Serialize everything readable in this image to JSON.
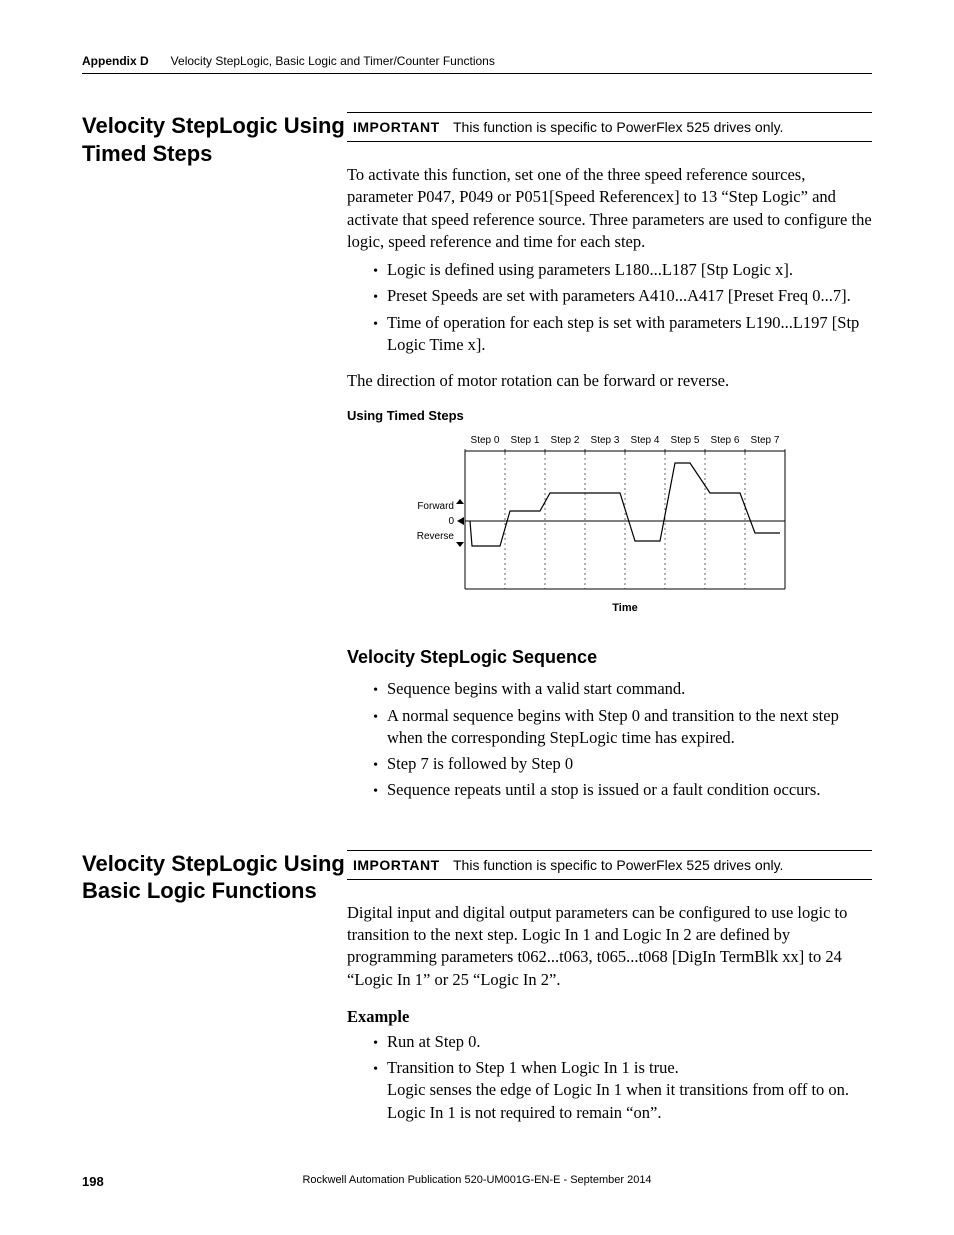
{
  "header": {
    "appendix": "Appendix D",
    "title": "Velocity StepLogic, Basic Logic and Timer/Counter Functions"
  },
  "section1": {
    "heading_l1": "Velocity StepLogic Using",
    "heading_l2": "Timed Steps",
    "important_label": "IMPORTANT",
    "important_text": "This function is specific to PowerFlex 525 drives only.",
    "para1": "To activate this function, set one of the three speed reference sources, parameter P047, P049 or P051[Speed Referencex] to 13 “Step Logic” and activate that speed reference source. Three parameters are used to configure the logic, speed reference and time for each step.",
    "bullets": [
      "Logic is defined using parameters L180...L187 [Stp Logic x].",
      "Preset Speeds are set with parameters A410...A417 [Preset Freq 0...7].",
      "Time of operation for each step is set with parameters L190...L197 [Stp Logic Time x]."
    ],
    "para2": "The direction of motor rotation can be forward or reverse.",
    "chart_title": "Using Timed Steps"
  },
  "chart_data": {
    "type": "line",
    "title": "Using Timed Steps",
    "xlabel": "Time",
    "ylabel": "",
    "x_ticks": [
      "Step 0",
      "Step 1",
      "Step 2",
      "Step 3",
      "Step 4",
      "Step 5",
      "Step 6",
      "Step 7"
    ],
    "y_labels": [
      "Forward",
      "0",
      "Reverse"
    ],
    "description": "Step chart showing motor direction (Forward/0/Reverse) over 8 timed steps. Step 0 reverse moderate, Step 1 ramps forward small, Step 2 forward higher, Step 3 forward same, Step 4 ramps down to reverse moderate, Step 5 ramps to high forward peak then back, Step 6 forward moderate, Step 7 ramps to reverse small.",
    "series": [
      {
        "name": "direction",
        "points": [
          {
            "step": 0,
            "value": -30
          },
          {
            "step": 1,
            "value": 15
          },
          {
            "step": 2,
            "value": 35
          },
          {
            "step": 3,
            "value": 35
          },
          {
            "step": 4,
            "value": -25
          },
          {
            "step": 5,
            "value": 65
          },
          {
            "step": 6,
            "value": 30
          },
          {
            "step": 7,
            "value": -15
          }
        ]
      }
    ],
    "ylim": [
      -70,
      70
    ]
  },
  "section2": {
    "heading": "Velocity StepLogic Sequence",
    "bullets": [
      "Sequence begins with a valid start command.",
      "A normal sequence begins with Step 0 and transition to the next step when the corresponding StepLogic time has expired.",
      "Step 7 is followed by Step 0",
      "Sequence repeats until a stop is issued or a fault condition occurs."
    ]
  },
  "section3": {
    "heading_l1": "Velocity StepLogic Using",
    "heading_l2": "Basic Logic Functions",
    "important_label": "IMPORTANT",
    "important_text": "This function is specific to PowerFlex 525 drives only.",
    "para1": "Digital input and digital output parameters can be configured to use logic to transition to the next step. Logic In 1 and Logic In 2 are defined by programming parameters t062...t063, t065...t068 [DigIn TermBlk xx] to 24 “Logic In 1” or 25 “Logic In 2”.",
    "example_label": "Example",
    "bullets": [
      "Run at Step 0.",
      "Transition to Step 1 when Logic In 1 is true."
    ],
    "bullet2_sub1": "Logic senses the edge of Logic In 1 when it transitions from off to on.",
    "bullet2_sub2": "Logic In 1 is not required to remain “on”."
  },
  "footer": {
    "page": "198",
    "pub": "Rockwell Automation Publication 520-UM001G-EN-E - September 2014"
  }
}
